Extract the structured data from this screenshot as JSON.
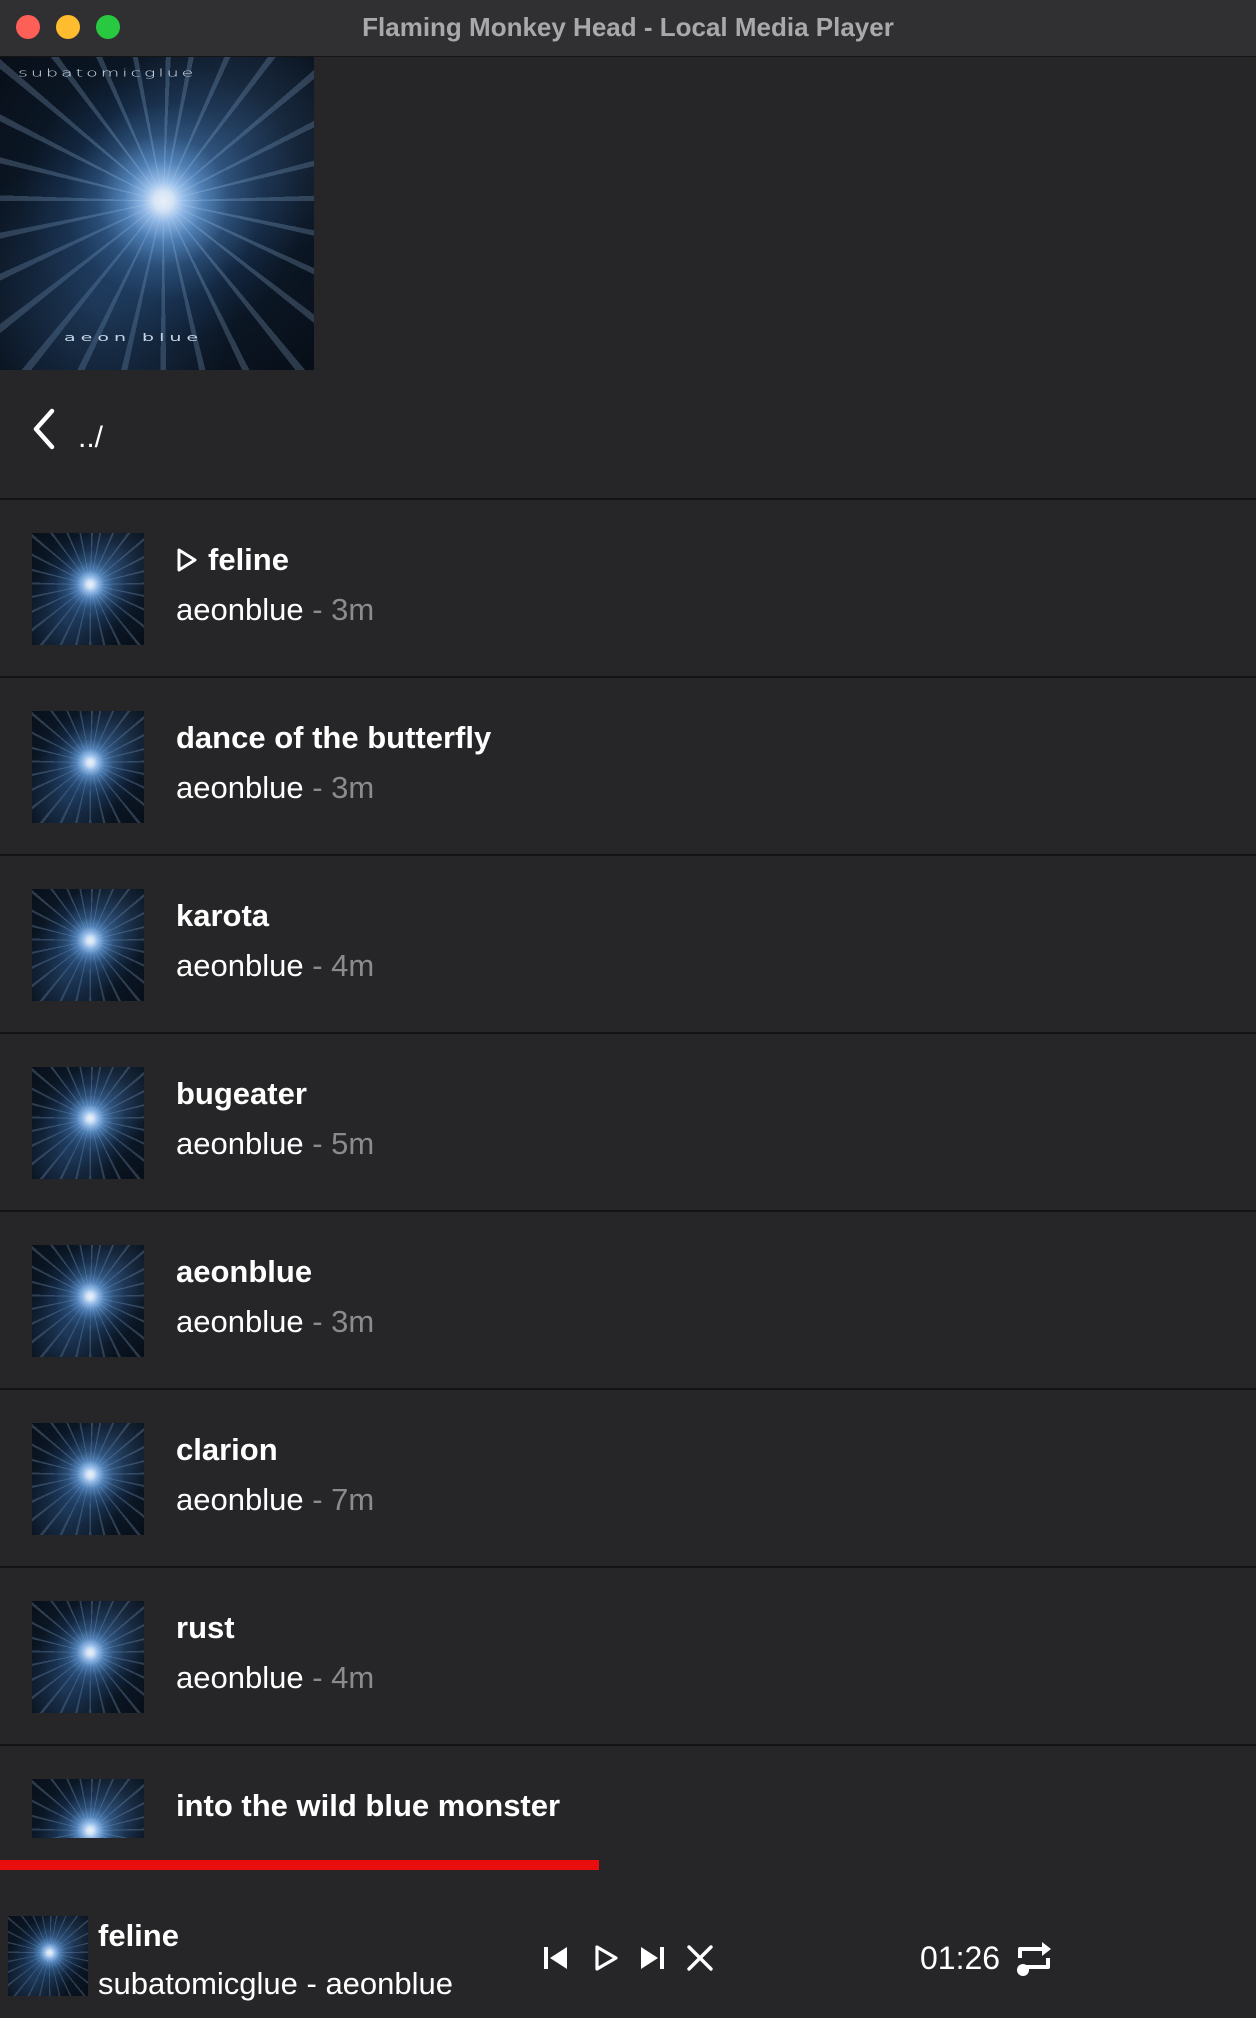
{
  "window": {
    "title": "Flaming Monkey Head - Local Media Player"
  },
  "album": {
    "art_top_text": "subatomicglue",
    "art_bottom_text": "aeon blue"
  },
  "navigation": {
    "back_label": "../"
  },
  "tracks": [
    {
      "title": "feline",
      "artist": "aeonblue",
      "separator": " - ",
      "duration": "3m",
      "playing": true
    },
    {
      "title": "dance of the butterfly",
      "artist": "aeonblue",
      "separator": " - ",
      "duration": "3m",
      "playing": false
    },
    {
      "title": "karota",
      "artist": "aeonblue",
      "separator": " - ",
      "duration": "4m",
      "playing": false
    },
    {
      "title": "bugeater",
      "artist": "aeonblue",
      "separator": " - ",
      "duration": "5m",
      "playing": false
    },
    {
      "title": "aeonblue",
      "artist": "aeonblue",
      "separator": " - ",
      "duration": "3m",
      "playing": false
    },
    {
      "title": "clarion",
      "artist": "aeonblue",
      "separator": " - ",
      "duration": "7m",
      "playing": false
    },
    {
      "title": "rust",
      "artist": "aeonblue",
      "separator": " - ",
      "duration": "4m",
      "playing": false
    },
    {
      "title": "into the wild blue monster",
      "artist": "",
      "separator": "",
      "duration": "",
      "playing": false
    }
  ],
  "player": {
    "now_playing_title": "feline",
    "now_playing_subtitle": "subatomicglue - aeonblue",
    "elapsed": "01:26",
    "progress_fraction": 0.477,
    "icons": [
      "previous-icon",
      "play-icon",
      "next-icon",
      "stop-icon",
      "repeat-icon"
    ]
  },
  "colors": {
    "background": "#262628",
    "progress": "#e80e0e",
    "secondary_text": "#8b8b8d",
    "divider": "#141416"
  }
}
